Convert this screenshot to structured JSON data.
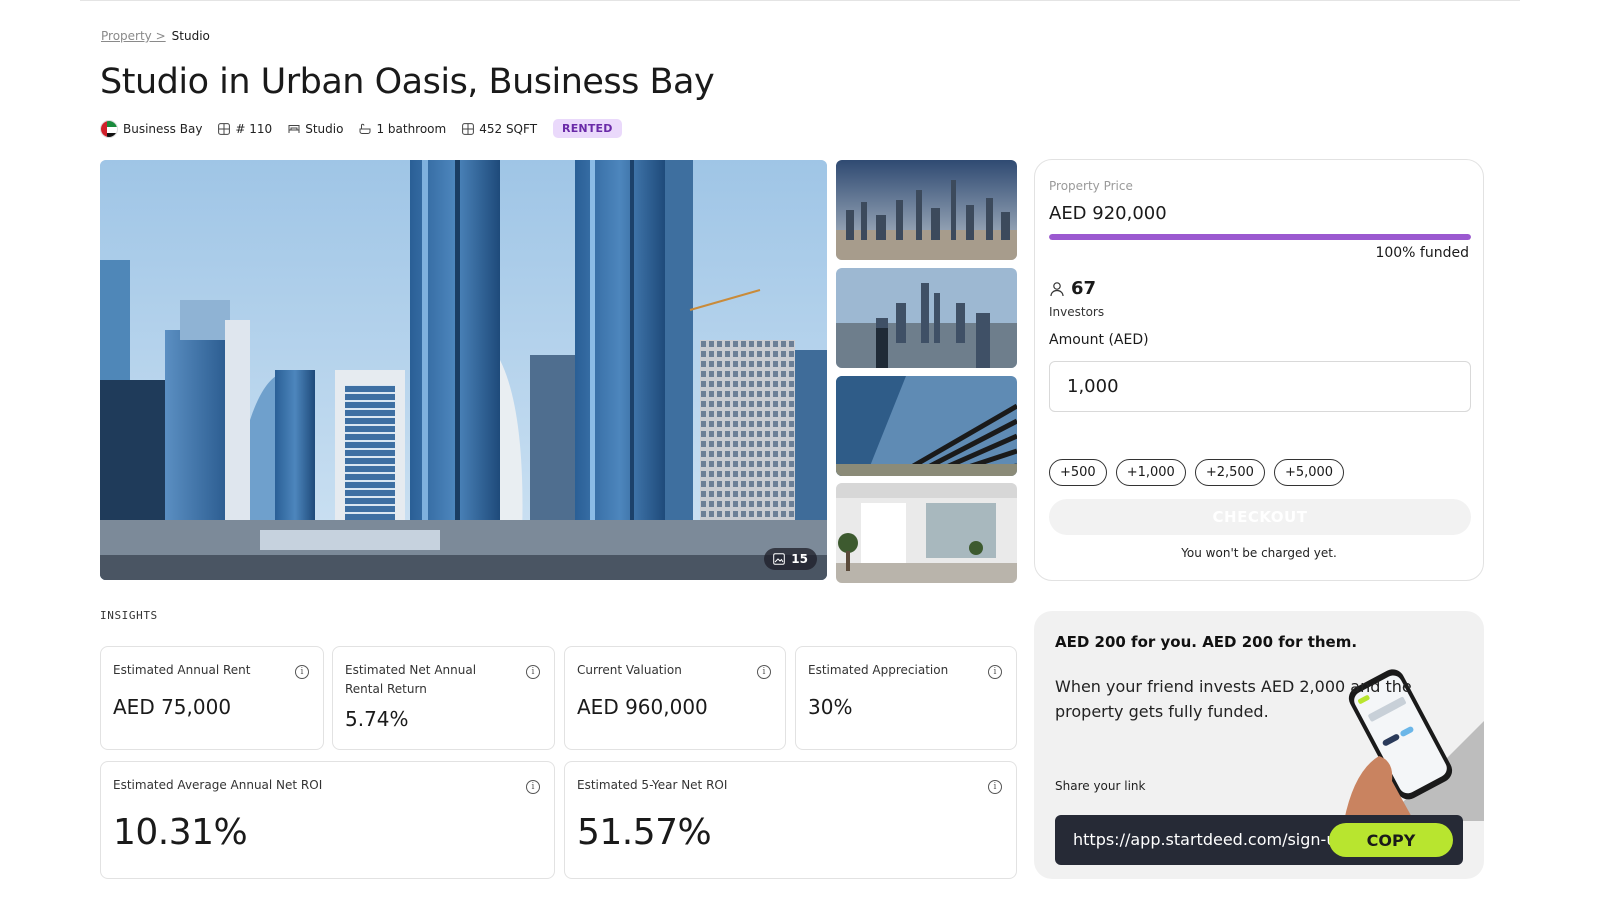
{
  "breadcrumb": {
    "parent": "Property >",
    "current": "Studio"
  },
  "title": "Studio in Urban Oasis, Business Bay",
  "meta": {
    "location": "Business Bay",
    "unit": "# 110",
    "type": "Studio",
    "bathrooms": "1 bathroom",
    "area": "452 SQFT",
    "status": "RENTED"
  },
  "gallery": {
    "photo_count": "15"
  },
  "insights": {
    "label": "INSIGHTS",
    "cards": [
      {
        "label": "Estimated Annual Rent",
        "value": "AED 75,000"
      },
      {
        "label": "Estimated Net Annual Rental Return",
        "value": "5.74%"
      },
      {
        "label": "Current Valuation",
        "value": "AED 960,000"
      },
      {
        "label": "Estimated Appreciation",
        "value": "30%"
      },
      {
        "label": "Estimated Average Annual Net ROI",
        "value": "10.31%"
      },
      {
        "label": "Estimated 5-Year Net ROI",
        "value": "51.57%"
      }
    ]
  },
  "invest": {
    "price_label": "Property Price",
    "price": "AED 920,000",
    "funded_fraction": 1.0,
    "funded_label": "100% funded",
    "investors_count": "67",
    "investors_label": "Investors",
    "amount_label": "Amount (AED)",
    "amount_value": "1,000",
    "quick_amounts": [
      "+500",
      "+1,000",
      "+2,500",
      "+5,000"
    ],
    "checkout_label": "CHECKOUT",
    "note": "You won't be charged yet."
  },
  "referral": {
    "title": "AED 200 for you. AED 200 for them.",
    "text": "When your friend invests AED 2,000 and the property gets fully funded.",
    "share_label": "Share your link",
    "link": "https://app.startdeed.com/sign-up",
    "copy_label": "COPY"
  },
  "colors": {
    "accent_purple": "#9b59d0",
    "badge_bg": "#ead9fb",
    "copy_green": "#b8e52f",
    "link_box_bg": "#262a36"
  }
}
